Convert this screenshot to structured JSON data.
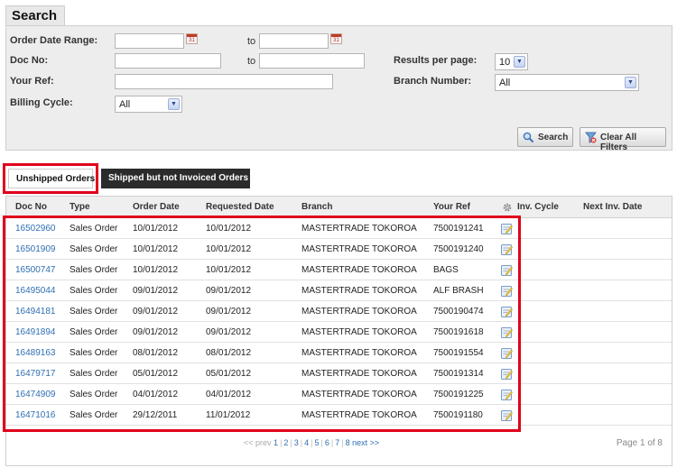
{
  "search": {
    "title": "Search",
    "order_date_range_label": "Order Date Range:",
    "doc_no_label": "Doc No:",
    "your_ref_label": "Your Ref:",
    "billing_cycle_label": "Billing Cycle:",
    "to_label": "to",
    "results_per_page_label": "Results per page:",
    "branch_number_label": "Branch Number:",
    "order_date_from": "",
    "order_date_to": "",
    "doc_no_from": "",
    "doc_no_to": "",
    "your_ref": "",
    "billing_cycle_value": "All",
    "results_per_page_value": "10",
    "branch_number_value": "All",
    "calendar_icon_text": "31",
    "search_button": "Search",
    "clear_button": "Clear All Filters"
  },
  "tabs": {
    "unshipped": "Unshipped Orders",
    "shipped_not_invoiced": "Shipped but not Invoiced Orders"
  },
  "table": {
    "headers": {
      "doc_no": "Doc No",
      "type": "Type",
      "order_date": "Order Date",
      "requested_date": "Requested Date",
      "branch": "Branch",
      "your_ref": "Your Ref",
      "inv_cycle": "Inv. Cycle",
      "next_inv_date": "Next Inv. Date"
    },
    "rows": [
      {
        "doc_no": "16502960",
        "type": "Sales Order",
        "order_date": "10/01/2012",
        "requested_date": "10/01/2012",
        "branch": "MASTERTRADE TOKOROA",
        "your_ref": "7500191241"
      },
      {
        "doc_no": "16501909",
        "type": "Sales Order",
        "order_date": "10/01/2012",
        "requested_date": "10/01/2012",
        "branch": "MASTERTRADE TOKOROA",
        "your_ref": "7500191240"
      },
      {
        "doc_no": "16500747",
        "type": "Sales Order",
        "order_date": "10/01/2012",
        "requested_date": "10/01/2012",
        "branch": "MASTERTRADE TOKOROA",
        "your_ref": "BAGS"
      },
      {
        "doc_no": "16495044",
        "type": "Sales Order",
        "order_date": "09/01/2012",
        "requested_date": "09/01/2012",
        "branch": "MASTERTRADE TOKOROA",
        "your_ref": "ALF BRASH"
      },
      {
        "doc_no": "16494181",
        "type": "Sales Order",
        "order_date": "09/01/2012",
        "requested_date": "09/01/2012",
        "branch": "MASTERTRADE TOKOROA",
        "your_ref": "7500190474"
      },
      {
        "doc_no": "16491894",
        "type": "Sales Order",
        "order_date": "09/01/2012",
        "requested_date": "09/01/2012",
        "branch": "MASTERTRADE TOKOROA",
        "your_ref": "7500191618"
      },
      {
        "doc_no": "16489163",
        "type": "Sales Order",
        "order_date": "08/01/2012",
        "requested_date": "08/01/2012",
        "branch": "MASTERTRADE TOKOROA",
        "your_ref": "7500191554"
      },
      {
        "doc_no": "16479717",
        "type": "Sales Order",
        "order_date": "05/01/2012",
        "requested_date": "05/01/2012",
        "branch": "MASTERTRADE TOKOROA",
        "your_ref": "7500191314"
      },
      {
        "doc_no": "16474909",
        "type": "Sales Order",
        "order_date": "04/01/2012",
        "requested_date": "04/01/2012",
        "branch": "MASTERTRADE TOKOROA",
        "your_ref": "7500191225"
      },
      {
        "doc_no": "16471016",
        "type": "Sales Order",
        "order_date": "29/12/2011",
        "requested_date": "11/01/2012",
        "branch": "MASTERTRADE TOKOROA",
        "your_ref": "7500191180"
      }
    ]
  },
  "pager": {
    "prev": "<< prev",
    "pages": [
      "1",
      "2",
      "3",
      "4",
      "5",
      "6",
      "7",
      "8"
    ],
    "next": "next >>",
    "page_of": "Page 1 of 8"
  },
  "colors": {
    "highlight": "#e0001b",
    "link": "#2f6fb3",
    "active_tab_bg": "#ffffff",
    "inactive_tab_bg": "#2b2b2b"
  }
}
